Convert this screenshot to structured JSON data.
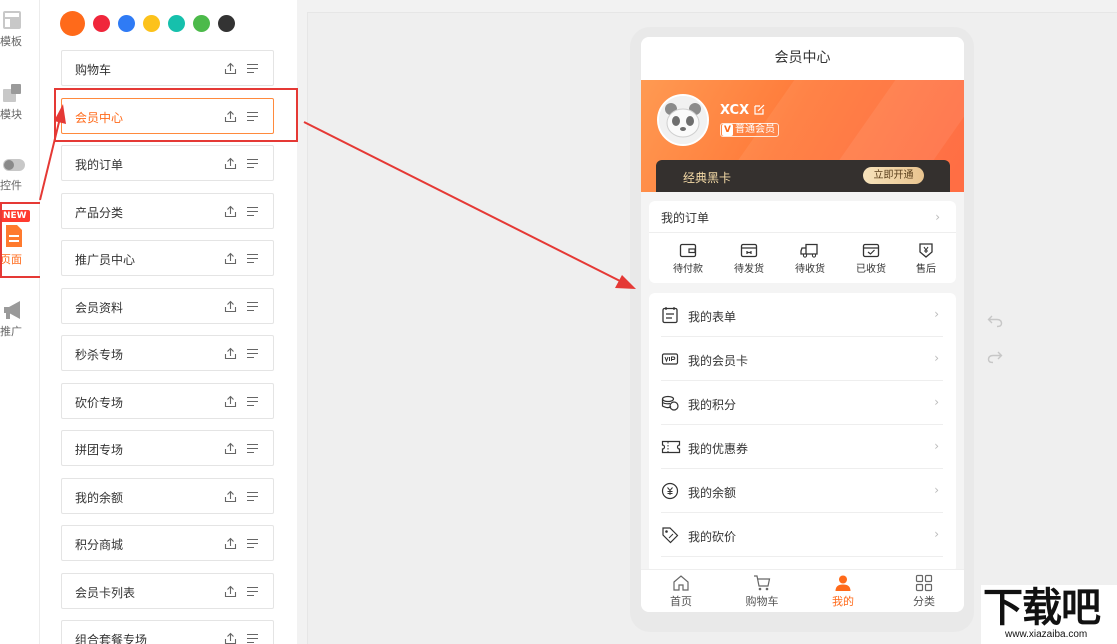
{
  "rail": {
    "items": [
      {
        "label": "模板",
        "icon": "template-icon"
      },
      {
        "label": "模块",
        "icon": "module-icon"
      },
      {
        "label": "控件",
        "icon": "toggle-icon"
      },
      {
        "label": "页面",
        "icon": "page-icon",
        "badge": "NEW",
        "active": true
      },
      {
        "label": "推广",
        "icon": "megaphone-icon"
      }
    ]
  },
  "theme_colors": [
    "#ff6a1a",
    "#f0263b",
    "#2f7bf5",
    "#fcc21b",
    "#16c0ac",
    "#4cba4a",
    "#333333"
  ],
  "pages": [
    {
      "label": "购物车"
    },
    {
      "label": "会员中心",
      "active": true
    },
    {
      "label": "我的订单"
    },
    {
      "label": "产品分类"
    },
    {
      "label": "推广员中心"
    },
    {
      "label": "会员资料"
    },
    {
      "label": "秒杀专场"
    },
    {
      "label": "砍价专场"
    },
    {
      "label": "拼团专场"
    },
    {
      "label": "我的余额"
    },
    {
      "label": "积分商城"
    },
    {
      "label": "会员卡列表"
    },
    {
      "label": "组合套餐专场"
    }
  ],
  "phone": {
    "title": "会员中心",
    "user": {
      "name": "XCX",
      "level_badge": "V",
      "level": "普通会员"
    },
    "vip_card": {
      "title": "经典黑卡",
      "button": "立即开通"
    },
    "orders": {
      "title": "我的订单",
      "chevron": "›",
      "items": [
        {
          "label": "待付款",
          "icon": "wallet-icon"
        },
        {
          "label": "待发货",
          "icon": "box-icon"
        },
        {
          "label": "待收货",
          "icon": "truck-icon"
        },
        {
          "label": "已收货",
          "icon": "check-box-icon"
        },
        {
          "label": "售后",
          "icon": "after-sale-icon"
        }
      ]
    },
    "menu": [
      {
        "label": "我的表单",
        "icon": "form-icon"
      },
      {
        "label": "我的会员卡",
        "icon": "vip-card-icon"
      },
      {
        "label": "我的积分",
        "icon": "points-icon"
      },
      {
        "label": "我的优惠券",
        "icon": "coupon-icon"
      },
      {
        "label": "我的余额",
        "icon": "balance-icon"
      },
      {
        "label": "我的砍价",
        "icon": "bargain-tag-icon"
      }
    ],
    "tabs": [
      {
        "label": "首页",
        "icon": "home-icon"
      },
      {
        "label": "购物车",
        "icon": "cart-icon"
      },
      {
        "label": "我的",
        "icon": "user-icon",
        "active": true
      },
      {
        "label": "分类",
        "icon": "category-icon"
      }
    ]
  },
  "accent_color": "#ff6a1a",
  "watermark": {
    "title": "下载吧",
    "url": "www.xiazaiba.com"
  }
}
